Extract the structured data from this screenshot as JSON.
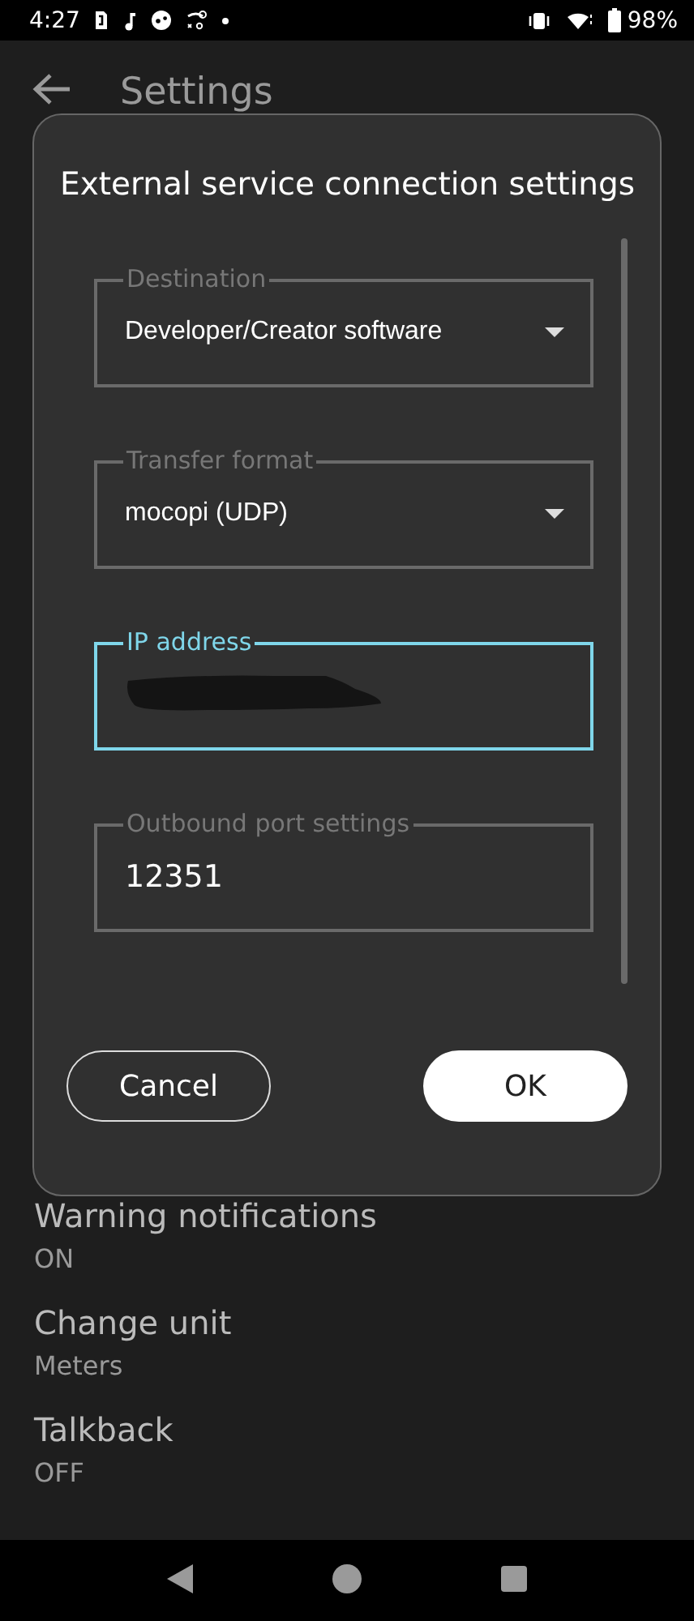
{
  "status_bar": {
    "time": "4:27",
    "battery": "98%"
  },
  "app_bar": {
    "title": "Settings"
  },
  "dialog": {
    "title": "External service connection settings",
    "fields": [
      {
        "kind": "dropdown",
        "label": "Destination",
        "value": "Developer/Creator software",
        "focused": false
      },
      {
        "kind": "dropdown",
        "label": "Transfer format",
        "value": "mocopi (UDP)",
        "focused": false
      },
      {
        "kind": "text",
        "label": "IP address",
        "redacted": true,
        "focused": true
      },
      {
        "kind": "text",
        "label": "Outbound port settings",
        "value": "12351",
        "focused": false
      }
    ],
    "buttons": [
      {
        "label": "Cancel",
        "kind": "outlined"
      },
      {
        "label": "OK",
        "kind": "filled"
      }
    ]
  },
  "settings": [
    {
      "title": "Warning notifications",
      "value": "ON"
    },
    {
      "title": "Change unit",
      "value": "Meters"
    },
    {
      "title": "Talkback",
      "value": "OFF"
    }
  ]
}
